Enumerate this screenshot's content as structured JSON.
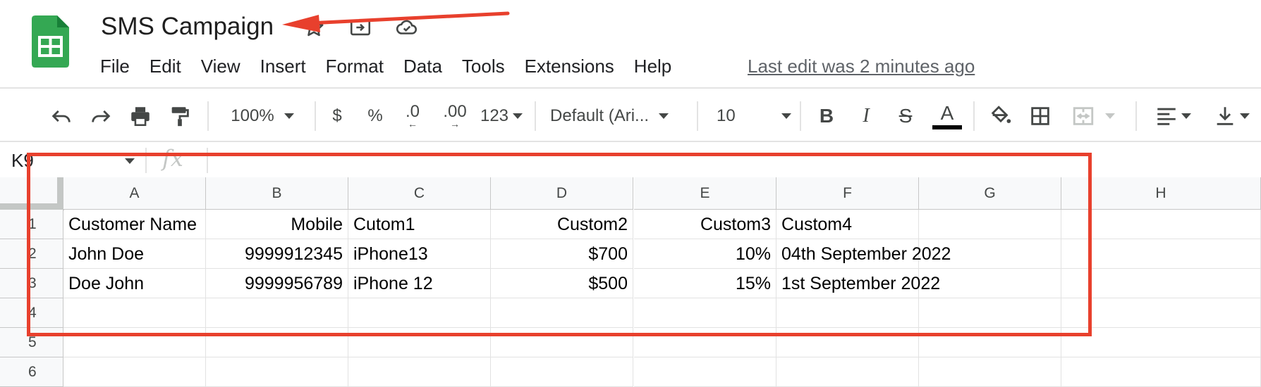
{
  "document": {
    "title": "SMS Campaign",
    "last_edit": "Last edit was 2 minutes ago"
  },
  "menu": [
    "File",
    "Edit",
    "View",
    "Insert",
    "Format",
    "Data",
    "Tools",
    "Extensions",
    "Help"
  ],
  "toolbar": {
    "zoom": "100%",
    "currency": "$",
    "percent": "%",
    "decrease_decimal": ".0",
    "increase_decimal": ".00",
    "number_format": "123",
    "font": "Default (Ari...",
    "font_size": "10",
    "bold": "B",
    "italic": "I",
    "strikethrough": "S",
    "text_color": "A"
  },
  "formula_bar": {
    "name_box": "K9",
    "fx": "fx"
  },
  "columns": [
    "A",
    "B",
    "C",
    "D",
    "E",
    "F",
    "G",
    "H"
  ],
  "rows": [
    {
      "num": "1",
      "cells": [
        "Customer Name",
        "Mobile",
        "Cutom1",
        "Custom2",
        "Custom3",
        "Custom4",
        "",
        ""
      ]
    },
    {
      "num": "2",
      "cells": [
        "John Doe",
        "9999912345",
        "iPhone13",
        "$700",
        "10%",
        "04th September 2022",
        "",
        ""
      ]
    },
    {
      "num": "3",
      "cells": [
        "Doe John",
        "9999956789",
        "iPhone 12",
        "$500",
        "15%",
        "1st September 2022",
        "",
        ""
      ]
    },
    {
      "num": "4",
      "cells": [
        "",
        "",
        "",
        "",
        "",
        "",
        "",
        ""
      ]
    },
    {
      "num": "5",
      "cells": [
        "",
        "",
        "",
        "",
        "",
        "",
        "",
        ""
      ]
    },
    {
      "num": "6",
      "cells": [
        "",
        "",
        "",
        "",
        "",
        "",
        "",
        ""
      ]
    }
  ],
  "colors": {
    "logo_green": "#34a853",
    "annotation_red": "#e8402d",
    "header_bg": "#f8f9fa"
  }
}
